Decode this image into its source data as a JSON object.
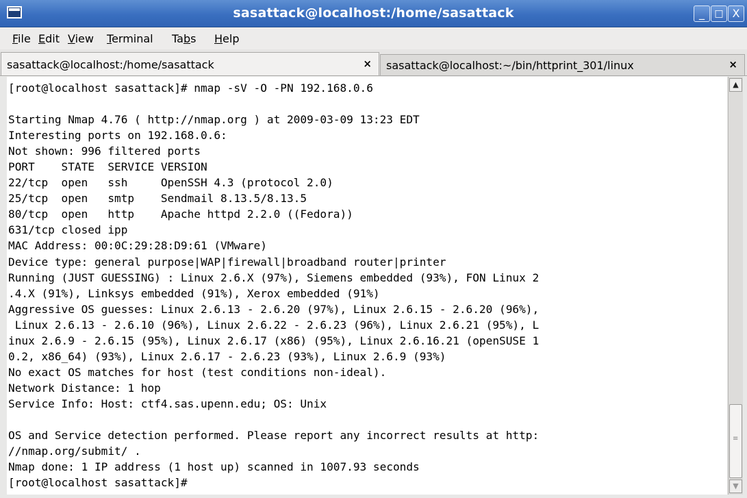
{
  "window": {
    "title": "sasattack@localhost:/home/sasattack",
    "controls": {
      "minimize": "_",
      "maximize": "□",
      "close": "X"
    }
  },
  "menu": {
    "items": [
      {
        "label": "File",
        "mnemonic": "F",
        "rest": "ile"
      },
      {
        "label": "Edit",
        "mnemonic": "E",
        "rest": "dit"
      },
      {
        "label": "View",
        "mnemonic": "V",
        "rest": "iew"
      },
      {
        "label": "Terminal",
        "mnemonic": "T",
        "rest": "erminal"
      },
      {
        "label": "Tabs",
        "pre": "Ta",
        "mnemonic": "b",
        "rest": "s"
      },
      {
        "label": "Help",
        "mnemonic": "H",
        "rest": "elp"
      }
    ]
  },
  "tabs": [
    {
      "label": "sasattack@localhost:/home/sasattack",
      "close": "×",
      "active": true
    },
    {
      "label": "sasattack@localhost:~/bin/httprint_301/linux",
      "close": "×",
      "active": false
    }
  ],
  "terminal": {
    "lines": [
      "[root@localhost sasattack]# nmap -sV -O -PN 192.168.0.6",
      "",
      "Starting Nmap 4.76 ( http://nmap.org ) at 2009-03-09 13:23 EDT",
      "Interesting ports on 192.168.0.6:",
      "Not shown: 996 filtered ports",
      "PORT    STATE  SERVICE VERSION",
      "22/tcp  open   ssh     OpenSSH 4.3 (protocol 2.0)",
      "25/tcp  open   smtp    Sendmail 8.13.5/8.13.5",
      "80/tcp  open   http    Apache httpd 2.2.0 ((Fedora))",
      "631/tcp closed ipp",
      "MAC Address: 00:0C:29:28:D9:61 (VMware)",
      "Device type: general purpose|WAP|firewall|broadband router|printer",
      "Running (JUST GUESSING) : Linux 2.6.X (97%), Siemens embedded (93%), FON Linux 2",
      ".4.X (91%), Linksys embedded (91%), Xerox embedded (91%)",
      "Aggressive OS guesses: Linux 2.6.13 - 2.6.20 (97%), Linux 2.6.15 - 2.6.20 (96%),",
      " Linux 2.6.13 - 2.6.10 (96%), Linux 2.6.22 - 2.6.23 (96%), Linux 2.6.21 (95%), L",
      "inux 2.6.9 - 2.6.15 (95%), Linux 2.6.17 (x86) (95%), Linux 2.6.16.21 (openSUSE 1",
      "0.2, x86_64) (93%), Linux 2.6.17 - 2.6.23 (93%), Linux 2.6.9 (93%)",
      "No exact OS matches for host (test conditions non-ideal).",
      "Network Distance: 1 hop",
      "Service Info: Host: ctf4.sas.upenn.edu; OS: Unix",
      "",
      "OS and Service detection performed. Please report any incorrect results at http:",
      "//nmap.org/submit/ .",
      "Nmap done: 1 IP address (1 host up) scanned in 1007.93 seconds",
      "[root@localhost sasattack]#"
    ]
  },
  "scrollbar": {
    "up": "▲",
    "down": "▼",
    "grip": "≡"
  }
}
